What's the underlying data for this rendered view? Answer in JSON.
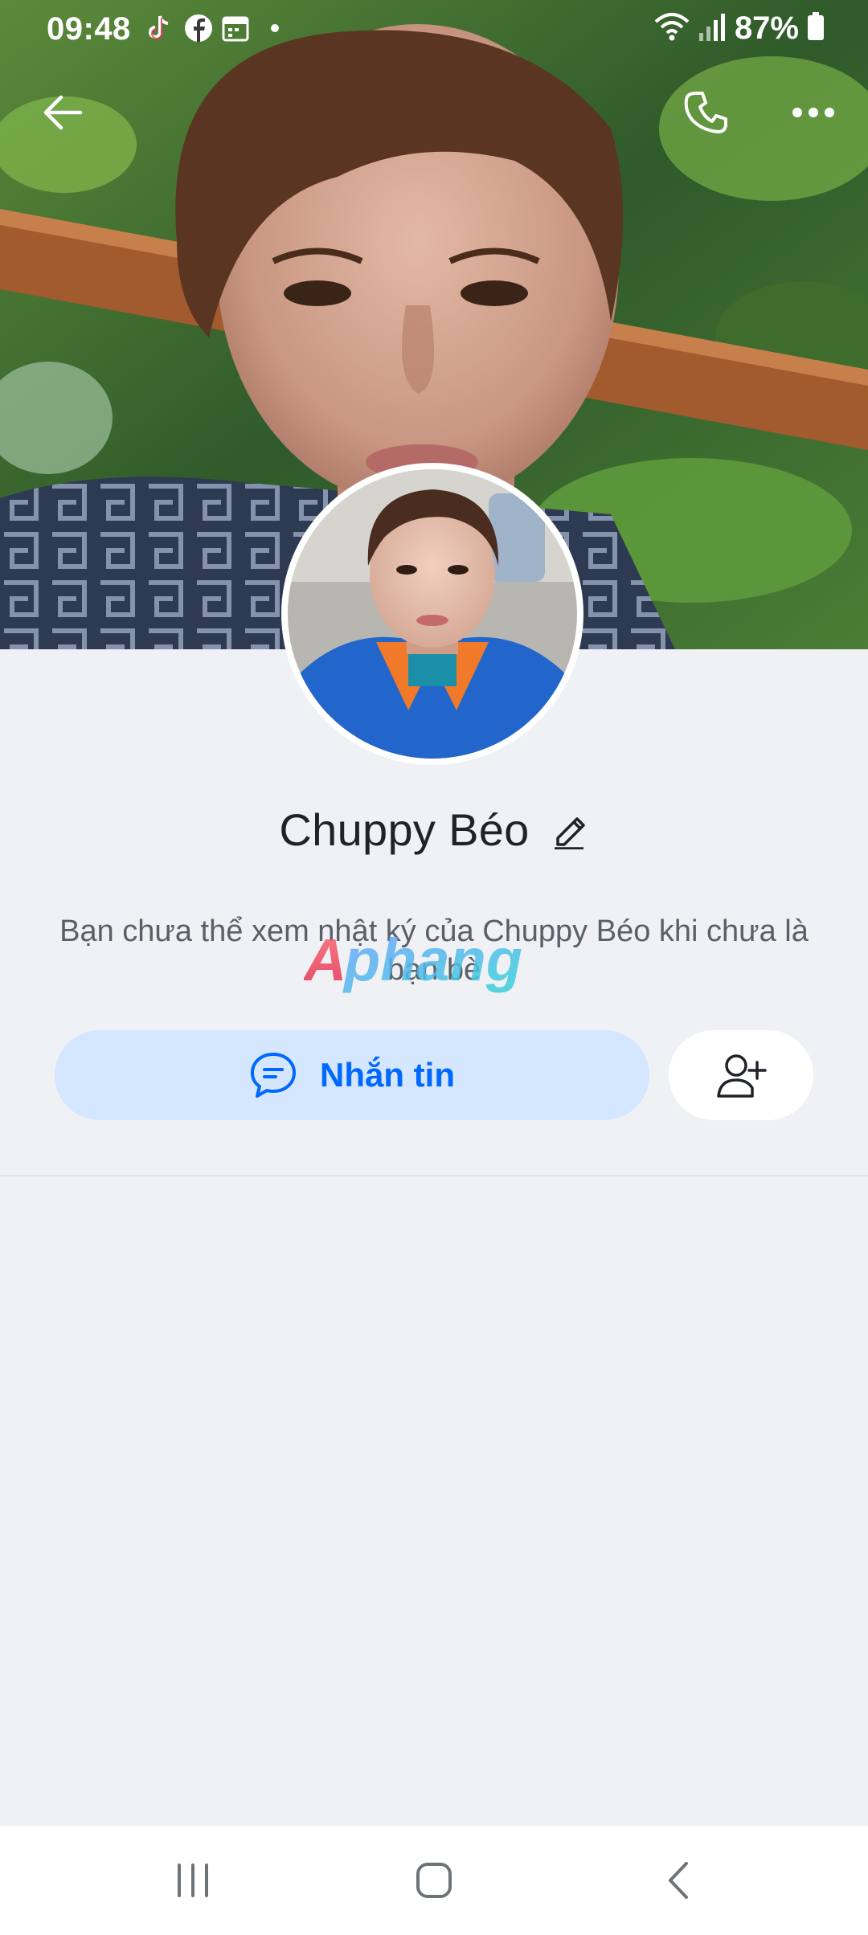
{
  "status_bar": {
    "time": "09:48",
    "battery": "87%",
    "notification_icons": [
      "tiktok-icon",
      "facebook-icon",
      "calendar-icon",
      "dot-icon"
    ],
    "system_icons": [
      "wifi-icon",
      "cellular-signal-icon",
      "battery-icon"
    ]
  },
  "header": {
    "back_icon": "arrow-left-icon",
    "call_icon": "phone-icon",
    "more_icon": "more-horizontal-icon"
  },
  "profile": {
    "name": "Chuppy Béo",
    "edit_icon": "pencil-icon",
    "notice": "Bạn chưa thể xem nhật ký của Chuppy Béo khi chưa là bạn bè"
  },
  "actions": {
    "message_label": "Nhắn tin",
    "message_icon": "chat-bubble-icon",
    "add_friend_icon": "add-user-icon"
  },
  "watermark": {
    "text": "Aphang"
  },
  "nav_bar": {
    "recents_icon": "recents-icon",
    "home_icon": "home-icon",
    "back_icon": "nav-back-icon"
  },
  "colors": {
    "background": "#eff1f5",
    "accent": "#0068ff",
    "message_button_bg": "#d4e7fe",
    "text_primary": "#1f2329",
    "text_secondary": "#5a6069"
  }
}
